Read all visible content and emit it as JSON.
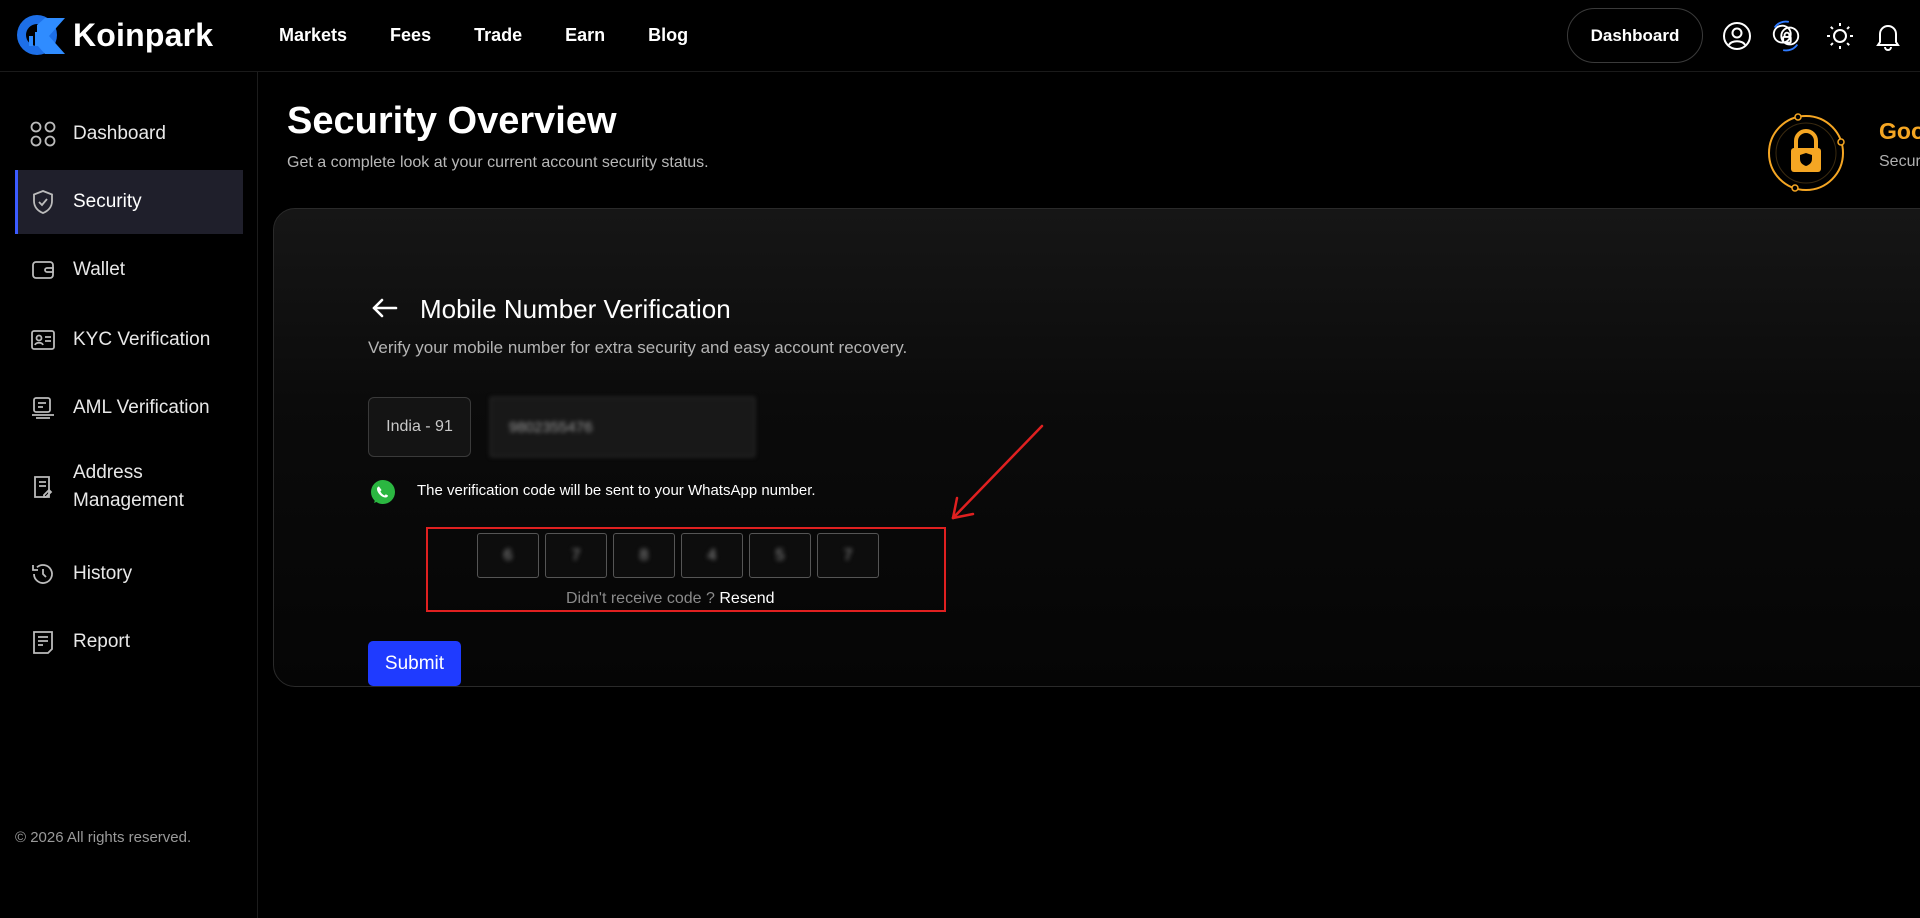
{
  "brand": {
    "name": "Koinpark"
  },
  "nav": {
    "items": [
      "Markets",
      "Fees",
      "Trade",
      "Earn",
      "Blog"
    ]
  },
  "header": {
    "dashboard_label": "Dashboard",
    "icons": [
      "user-icon",
      "security-badge-icon",
      "theme-sun-icon",
      "bell-icon"
    ]
  },
  "sidebar": {
    "items": [
      {
        "label": "Dashboard",
        "icon": "grid-icon"
      },
      {
        "label": "Security",
        "icon": "shield-icon",
        "active": true
      },
      {
        "label": "Wallet",
        "icon": "wallet-icon"
      },
      {
        "label": "KYC Verification",
        "icon": "id-card-icon"
      },
      {
        "label": "AML Verification",
        "icon": "aml-icon"
      },
      {
        "label_line1": "Address",
        "label_line2": "Management",
        "icon": "address-icon"
      },
      {
        "label": "History",
        "icon": "history-icon"
      },
      {
        "label": "Report",
        "icon": "report-icon"
      }
    ],
    "copyright": "© 2026 All rights reserved."
  },
  "page": {
    "title": "Security Overview",
    "subtitle": "Get a complete look at your current account security status.",
    "status_title": "Good",
    "status_subtitle": "Security"
  },
  "verification": {
    "title": "Mobile Number Verification",
    "subtitle": "Verify your mobile number for extra security and easy account recovery.",
    "country_code": "India - 91",
    "phone_value": "9802355476",
    "whatsapp_note": "The verification code will be sent to your WhatsApp number.",
    "otp_digits": [
      "6",
      "7",
      "8",
      "4",
      "5",
      "7"
    ],
    "resend_prompt": "Didn't receive code ?",
    "resend_label": "Resend",
    "submit_label": "Submit"
  },
  "colors": {
    "accent_blue": "#1f3bff",
    "active_sidebar_bar": "#3b5bff",
    "status_orange": "#f5a623",
    "annotation_red": "#e02020"
  }
}
